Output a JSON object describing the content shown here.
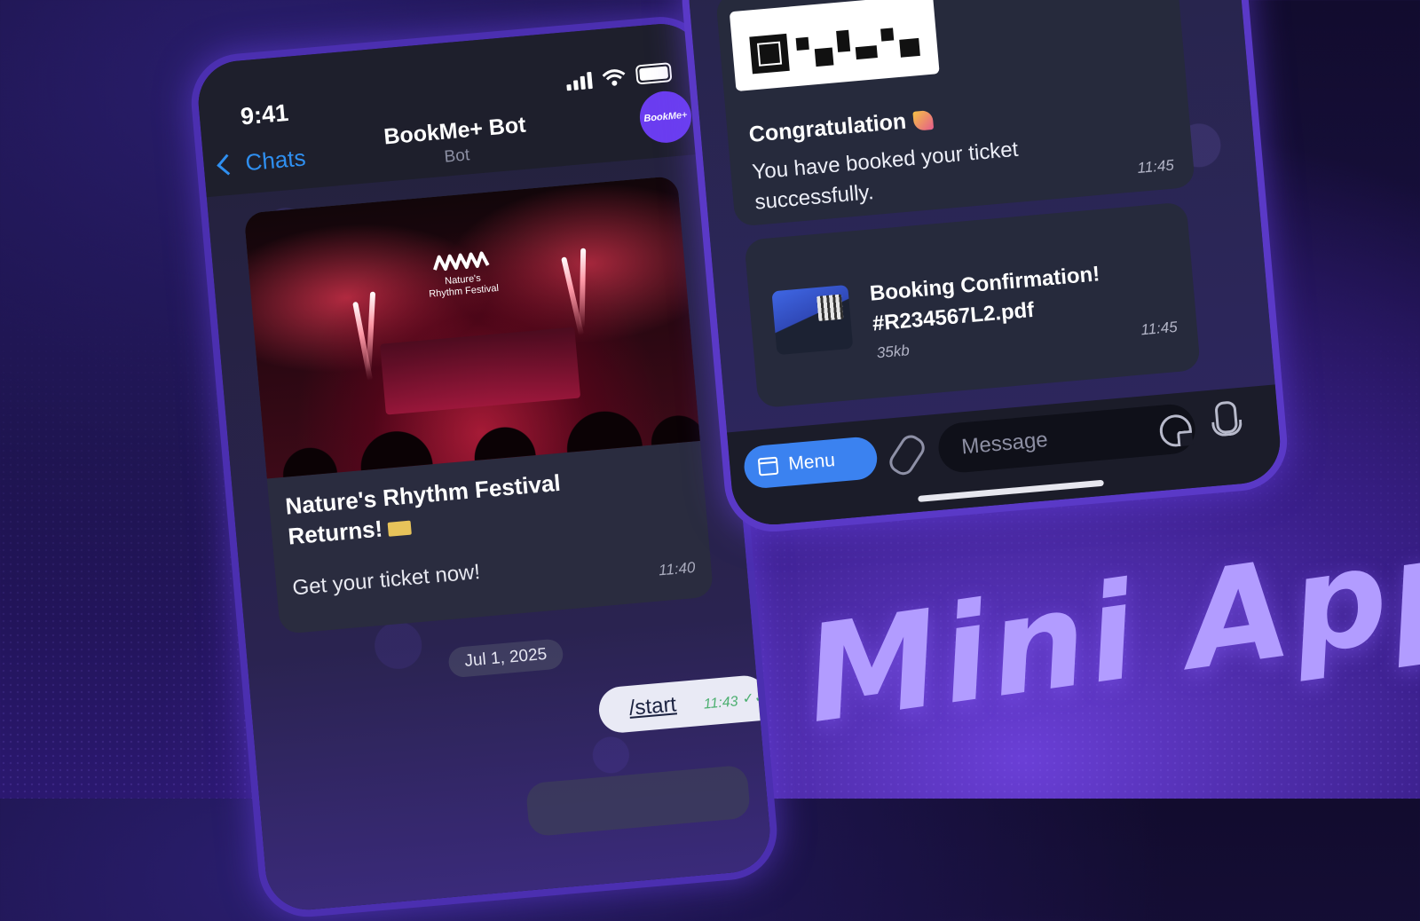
{
  "phone1": {
    "status": {
      "time": "9:41"
    },
    "header": {
      "back_label": "Chats",
      "bot_name": "BookMe+ Bot",
      "bot_subtitle": "Bot",
      "avatar_text": "BookMe+"
    },
    "promo_card": {
      "festival_logo_line1": "Nature's",
      "festival_logo_line2": "Rhythm Festival",
      "title": "Nature's Rhythm Festival Returns!",
      "text": "Get your ticket now!",
      "time": "11:40"
    },
    "date_separator": "Jul 1, 2025",
    "outgoing": {
      "text": "/start",
      "time": "11:43",
      "status_icon": "double-check-icon"
    }
  },
  "phone2": {
    "congrats_message": {
      "title": "Congratulation",
      "text": "You have booked your ticket successfully.",
      "time": "11:45"
    },
    "file_message": {
      "file_name": "Booking Confirmation! #R234567L2.pdf",
      "file_size": "35kb",
      "time": "11:45"
    },
    "input_bar": {
      "menu_label": "Menu",
      "placeholder": "Message"
    }
  },
  "headline": "Mini App",
  "colors": {
    "accent_purple": "#6b3df0",
    "telegram_blue": "#3b82f0",
    "headline_lilac": "#b29cff",
    "check_green": "#4caf70"
  }
}
